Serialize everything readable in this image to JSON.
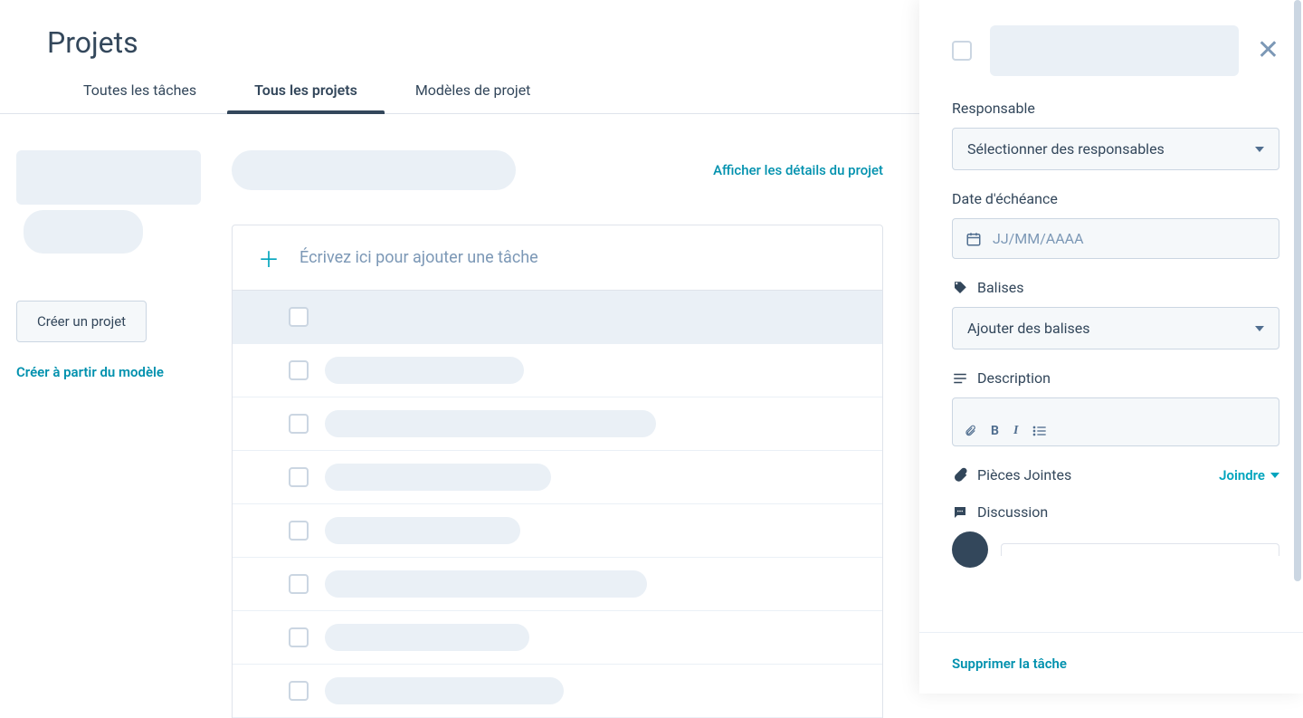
{
  "page_title": "Projets",
  "tabs": {
    "all_tasks": "Toutes les tâches",
    "all_projects": "Tous les projets",
    "templates": "Modèles de projet"
  },
  "sidebar": {
    "create_project": "Créer un projet",
    "create_from_template": "Créer à partir du modèle"
  },
  "main": {
    "show_details": "Afficher les détails du projet",
    "add_task_placeholder": "Écrivez ici pour ajouter une tâche"
  },
  "task_skeleton_widths": [
    284,
    220,
    366,
    250,
    216,
    356,
    226,
    264
  ],
  "panel": {
    "owner_label": "Responsable",
    "owner_placeholder": "Sélectionner des responsables",
    "due_label": "Date d'échéance",
    "due_placeholder": "JJ/MM/AAAA",
    "tags_label": "Balises",
    "tags_placeholder": "Ajouter des balises",
    "desc_label": "Description",
    "attach_label": "Pièces Jointes",
    "attach_action": "Joindre",
    "discussion_label": "Discussion",
    "delete_task": "Supprimer la tâche"
  }
}
